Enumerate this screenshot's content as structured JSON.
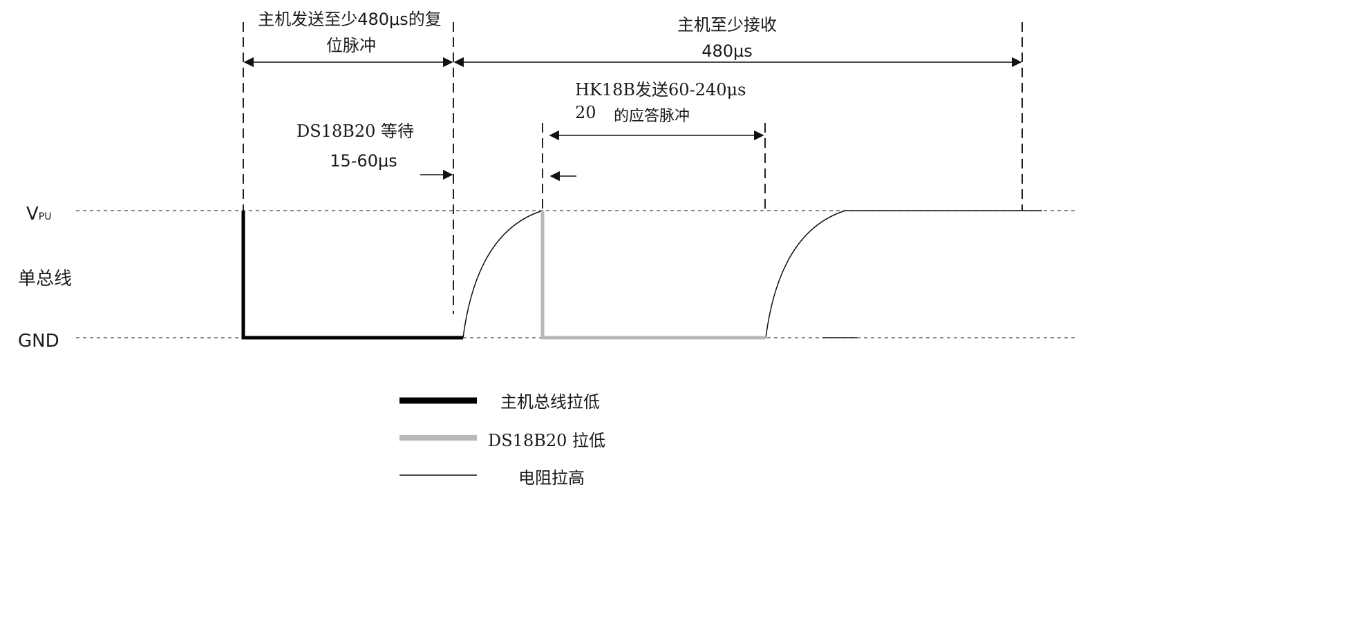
{
  "labels": {
    "vpu_main": "V",
    "vpu_sub": "PU",
    "bus": "单总线",
    "gnd": "GND"
  },
  "annotations": {
    "reset_line1": "主机发送至少480μs的复",
    "reset_line2": "位脉冲",
    "receive_line1": "主机至少接收",
    "receive_line2": "480μs",
    "wait_line1": "DS18B20 等待",
    "wait_line2": "15-60μs",
    "presence_line1": "HK18B发送60-240μs",
    "presence_line2": "20",
    "presence_line3": "的应答脉冲"
  },
  "legend": {
    "host_pull_low": "主机总线拉低",
    "device_pull_low": "DS18B20 拉低",
    "resistor_pull_high": "电阻拉高"
  },
  "colors": {
    "host_pull_low": "#000000",
    "device_pull_low": "#b8b8b8",
    "resistor_pull_high": "#111111",
    "guide_lines": "#222222"
  }
}
